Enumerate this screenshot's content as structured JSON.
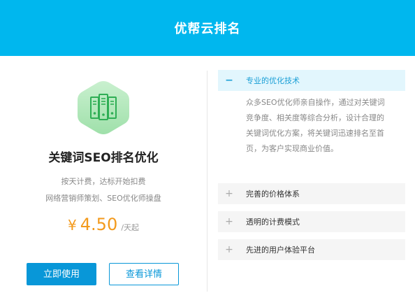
{
  "header": {
    "title": "优帮云排名"
  },
  "product": {
    "title": "关键词SEO排名优化",
    "desc_line1": "按天计费，达标开始扣费",
    "desc_line2": "网络营销师策划、SEO优化师操盘",
    "price_currency": "¥",
    "price_value": "4.50",
    "price_unit": "/天起",
    "icon": "server-icon",
    "icon_color": "#3cbb63"
  },
  "buttons": {
    "use_label": "立即使用",
    "detail_label": "查看详情"
  },
  "accordion": {
    "items": [
      {
        "label": "专业的优化技术",
        "toggle": "−",
        "content": "众多SEO优化师亲自操作，通过对关键词竞争度、相关度等综合分析，设计合理的关键词优化方案，将关键词迅速排名至首页，为客户实现商业价值。"
      },
      {
        "label": "完善的价格体系",
        "toggle": "+"
      },
      {
        "label": "透明的计费模式",
        "toggle": "+"
      },
      {
        "label": "先进的用户体验平台",
        "toggle": "+"
      }
    ]
  },
  "colors": {
    "header_bg": "#00b7ee",
    "accent": "#0897d8",
    "price": "#f39a1c"
  }
}
